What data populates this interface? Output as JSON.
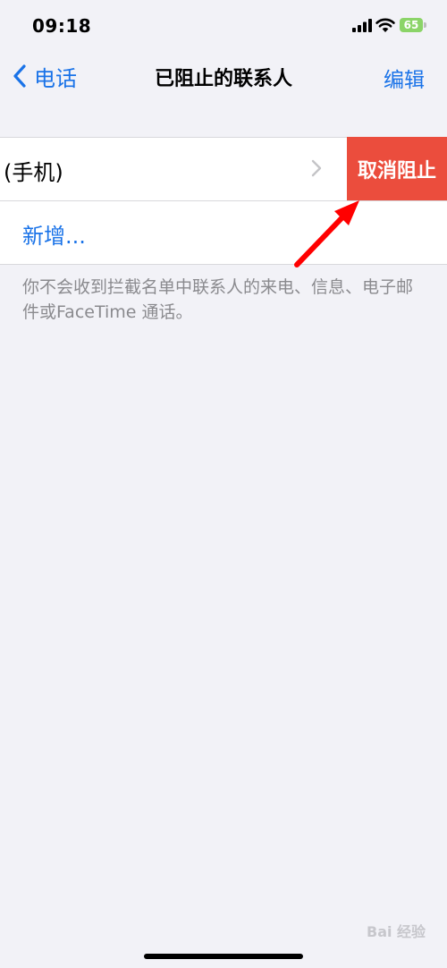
{
  "status_bar": {
    "time": "09:18",
    "battery": "65"
  },
  "nav": {
    "back_label": "电话",
    "title": "已阻止的联系人",
    "edit_label": "编辑"
  },
  "blocked_list": {
    "contact_label": "(手机)",
    "unblock_label": "取消阻止",
    "add_label": "新增..."
  },
  "footer_note": "你不会收到拦截名单中联系人的来电、信息、电子邮件或FaceTime 通话。",
  "watermark": "Bai 经验",
  "colors": {
    "accent": "#1a73e8",
    "destructive": "#eb4d3d",
    "background": "#f2f2f7",
    "annotation_arrow": "#ff0000"
  }
}
